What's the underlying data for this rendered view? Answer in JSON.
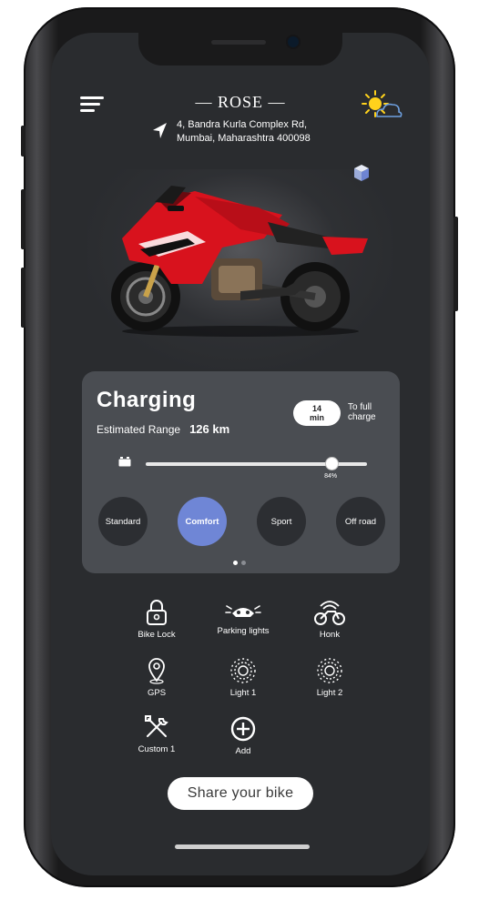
{
  "header": {
    "title": "— ROSE —",
    "address_line1": "4, Bandra Kurla Complex Rd,",
    "address_line2": "Mumbai, Maharashtra 400098"
  },
  "status": {
    "title": "Charging",
    "range_label": "Estimated Range",
    "range_value": "126 km",
    "time_value": "14",
    "time_unit": "min",
    "time_caption_line1": "To full",
    "time_caption_line2": "charge",
    "battery_label": "84%",
    "battery_percent": 84
  },
  "modes": [
    {
      "label": "Standard",
      "active": false
    },
    {
      "label": "Comfort",
      "active": true
    },
    {
      "label": "Sport",
      "active": false
    },
    {
      "label": "Off road",
      "active": false
    }
  ],
  "features": [
    {
      "label": "Bike Lock",
      "icon": "lock-icon"
    },
    {
      "label": "Parking lights",
      "icon": "parking-lights-icon"
    },
    {
      "label": "Honk",
      "icon": "honk-icon"
    },
    {
      "label": "GPS",
      "icon": "gps-icon"
    },
    {
      "label": "Light 1",
      "icon": "light-icon"
    },
    {
      "label": "Light 2",
      "icon": "light-icon"
    },
    {
      "label": "Custom 1",
      "icon": "tools-icon"
    },
    {
      "label": "Add",
      "icon": "add-icon"
    }
  ],
  "share_label": "Share your bike",
  "colors": {
    "accent": "#6f86d6",
    "card": "#4a4d52",
    "background": "#2a2c2f",
    "bike": "#d8121d"
  },
  "pager": {
    "count": 2,
    "active": 0
  }
}
